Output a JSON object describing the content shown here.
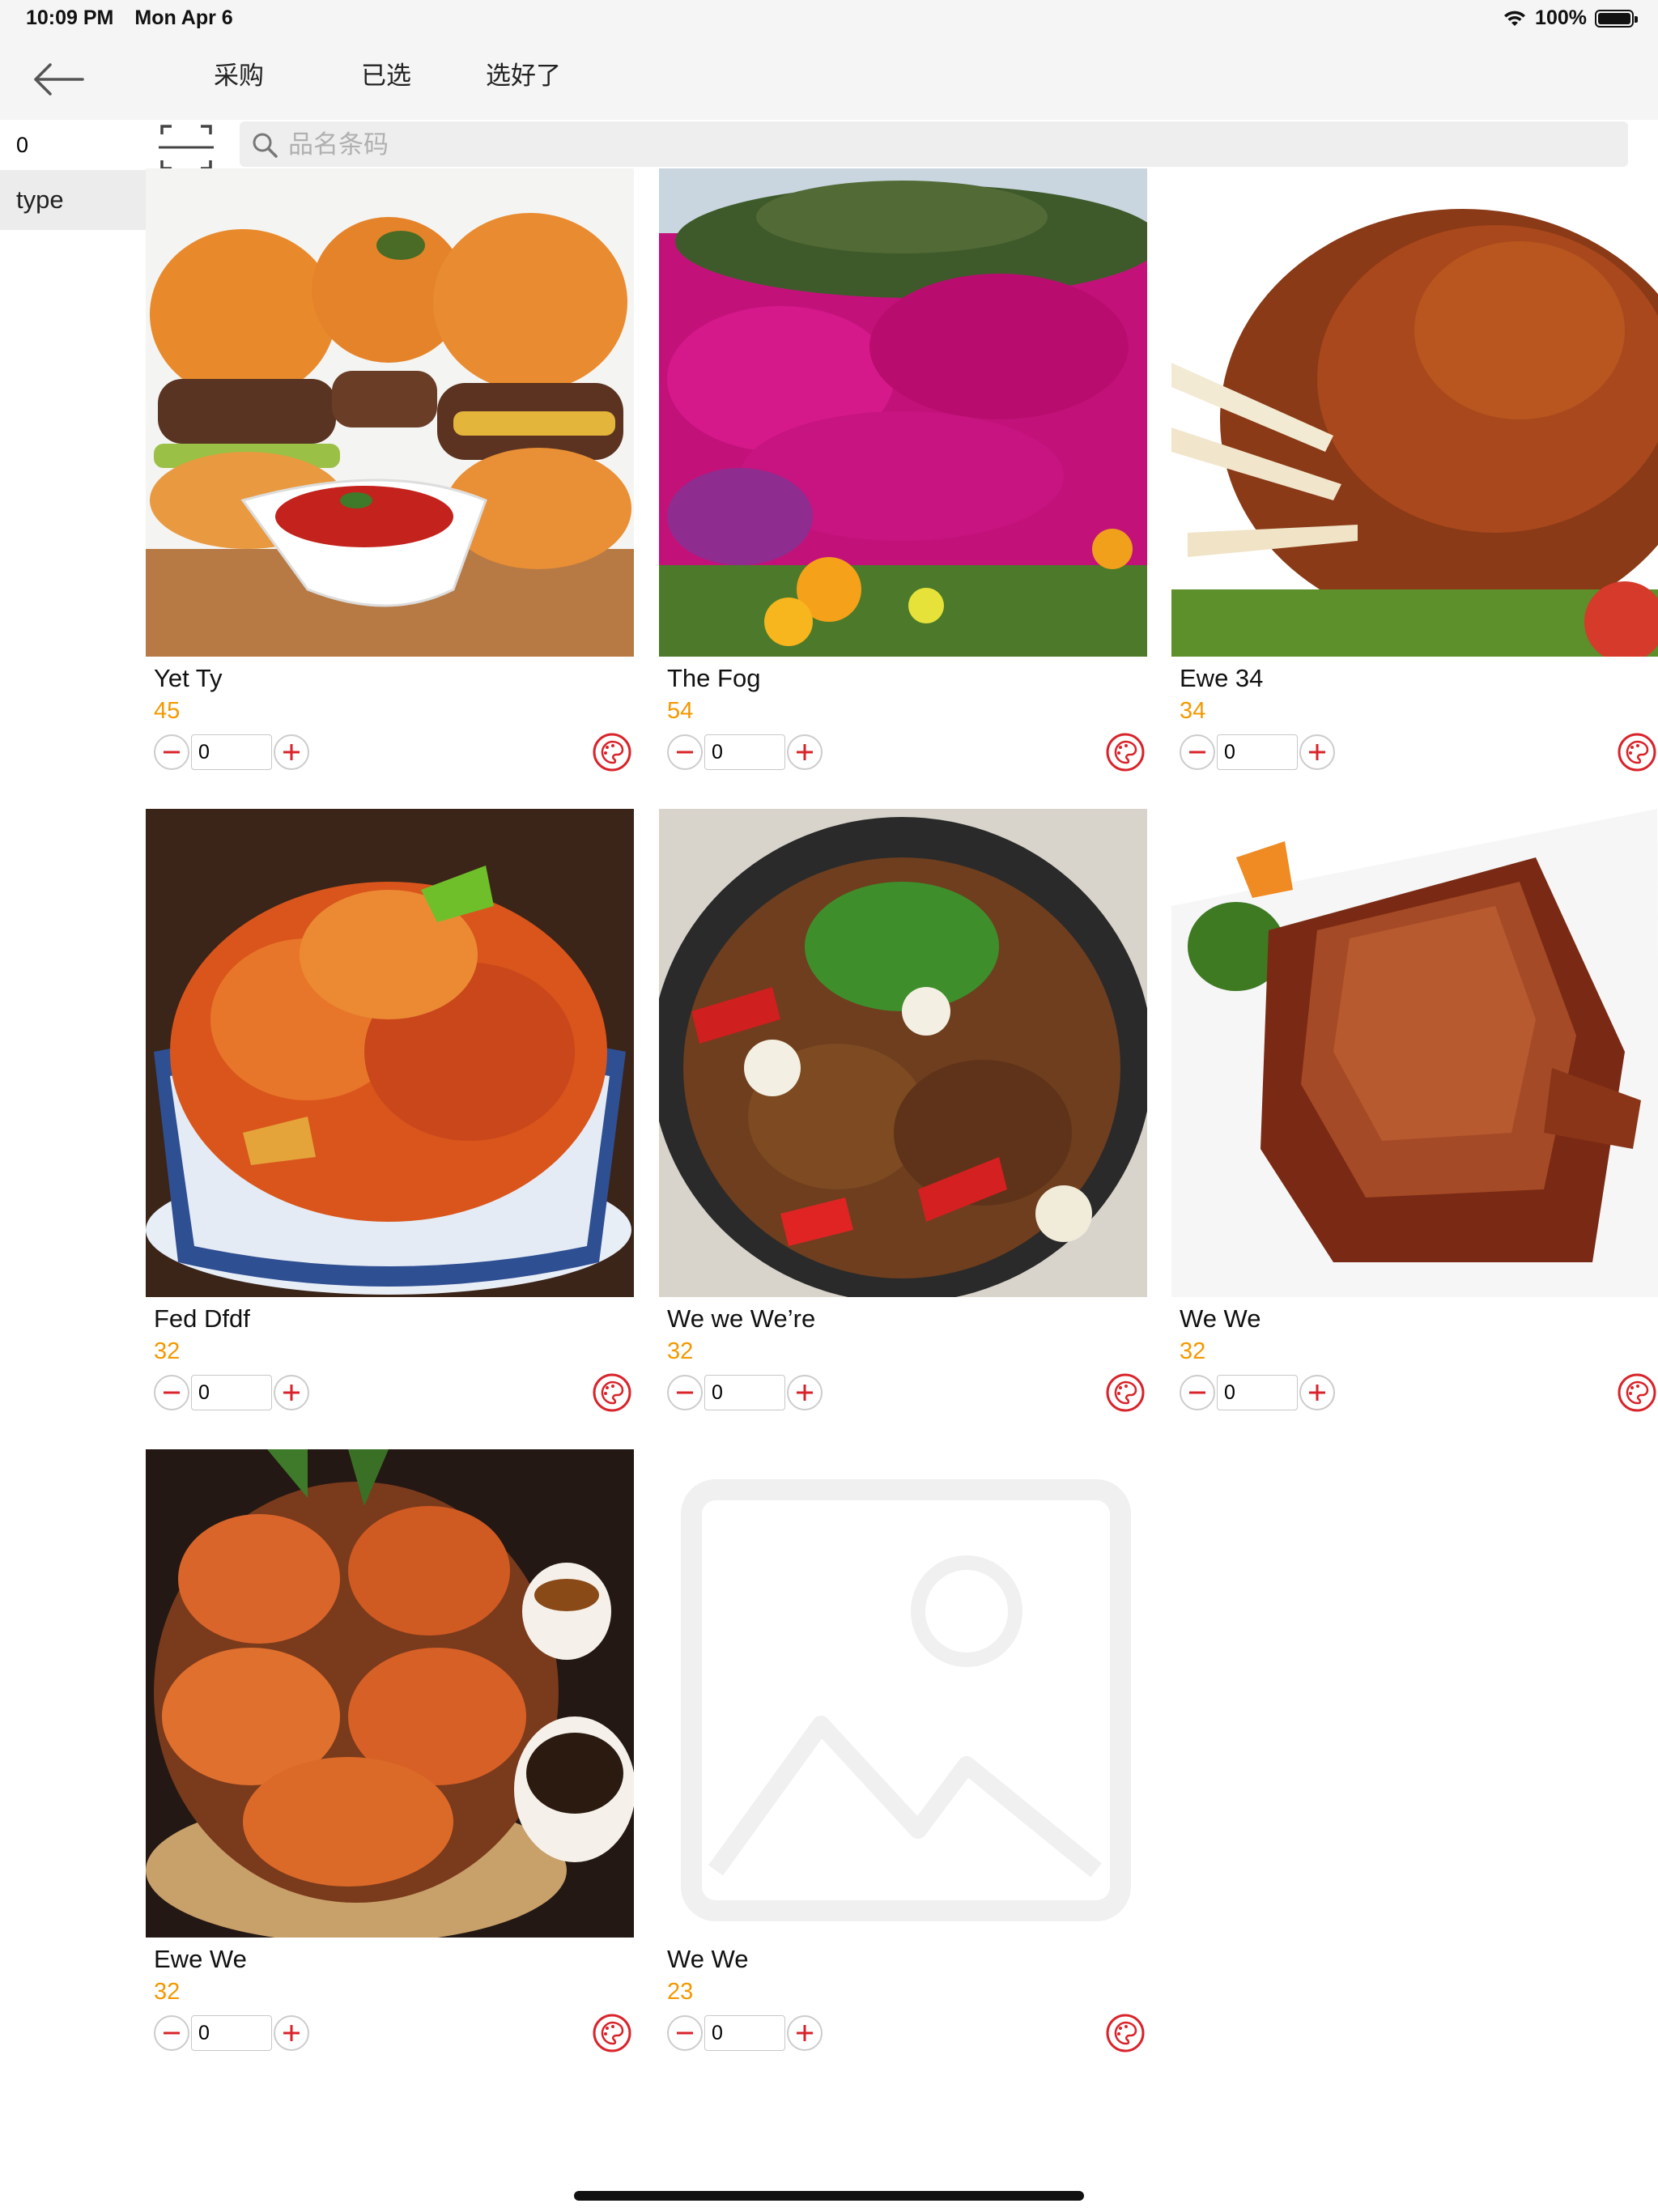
{
  "status_bar": {
    "time": "10:09 PM",
    "date": "Mon Apr 6",
    "battery": "100%"
  },
  "nav": {
    "tabs": [
      "采购",
      "已选",
      "选好了"
    ]
  },
  "search": {
    "count_value": "0",
    "placeholder": "品名条码"
  },
  "sidebar": {
    "items": [
      {
        "label": "type"
      }
    ]
  },
  "colors": {
    "price": "#f39800",
    "accent_red": "#d9232a",
    "bar_bg": "#f5f5f5"
  },
  "products": [
    {
      "name": "Yet Ty",
      "price": "45",
      "qty": "0",
      "image": "burgers"
    },
    {
      "name": "The Fog",
      "price": "54",
      "qty": "0",
      "image": "flowers"
    },
    {
      "name": "Ewe 34",
      "price": "34",
      "qty": "0",
      "image": "roast-ribs"
    },
    {
      "name": "Fed Dfdf",
      "price": "32",
      "qty": "0",
      "image": "crayfish"
    },
    {
      "name": "We we We’re",
      "price": "32",
      "qty": "0",
      "image": "stir-fry"
    },
    {
      "name": "We We",
      "price": "32",
      "qty": "0",
      "image": "roast-duck"
    },
    {
      "name": "Ewe We",
      "price": "32",
      "qty": "0",
      "image": "crabs"
    },
    {
      "name": "We We",
      "price": "23",
      "qty": "0",
      "image": "placeholder"
    }
  ]
}
